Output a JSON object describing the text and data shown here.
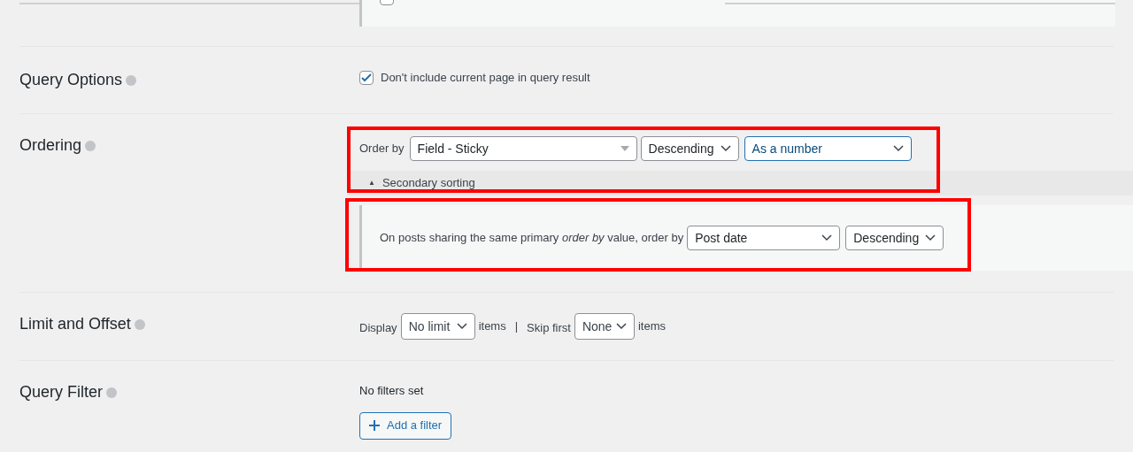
{
  "top_panel": {
    "checkbox_checked": false
  },
  "sections": [
    {
      "kind": "options",
      "label": "Query Options",
      "checkbox": {
        "label": "Don't include current page in query result",
        "checked": true
      }
    },
    {
      "kind": "ordering",
      "label": "Ordering",
      "order_by_label": "Order by",
      "order_by": "Field - Sticky",
      "direction": "Descending",
      "cast": "As a number",
      "secondary": {
        "toggle": "▲",
        "label": "Secondary sorting",
        "expanded": true,
        "sentence": "On posts sharing the same primary *order by* value, order by",
        "order_by": "Post date",
        "direction": "Descending"
      }
    },
    {
      "kind": "limit",
      "label": "Limit and Offset",
      "display_label": "Display",
      "display": "No limit",
      "items_label_1": "items",
      "separator": "|",
      "skip_label": "Skip first",
      "skip": "None",
      "items_label_2": "items"
    },
    {
      "kind": "filter",
      "label": "Query Filter",
      "empty_text": "No filters set",
      "add_button": "Add a filter"
    }
  ],
  "annotations": [
    {
      "kind": "highlight"
    },
    {
      "kind": "highlight"
    }
  ]
}
